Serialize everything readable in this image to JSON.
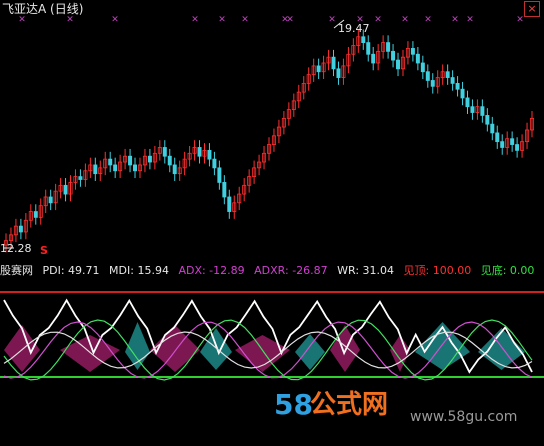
{
  "chart_window": {
    "title": "飞亚达A (日线)",
    "close_label": "×",
    "price_high_label": "19.47",
    "price_low_label": "12.28",
    "signal_label": "S"
  },
  "indicator": {
    "name": "股赛网",
    "items": [
      {
        "key": "PDI",
        "text": "PDI: 49.71",
        "color": "#e8e8e8"
      },
      {
        "key": "MDI",
        "text": "MDI: 15.94",
        "color": "#e8e8e8"
      },
      {
        "key": "ADX",
        "text": "ADX: -12.89",
        "color": "#d040d0"
      },
      {
        "key": "ADXR",
        "text": "ADXR: -26.87",
        "color": "#d040d0"
      },
      {
        "key": "WR",
        "text": "WR: 31.04",
        "color": "#e8e8e8"
      },
      {
        "key": "见顶",
        "text": "见顶: 100.00",
        "color": "#ff3030"
      },
      {
        "key": "见底",
        "text": "见底: 0.00",
        "color": "#30e040"
      }
    ]
  },
  "watermark": {
    "number": "58",
    "chinese": "公式网",
    "url": "www.58gu.com"
  },
  "colors": {
    "up": "#ff3030",
    "down": "#40d0e0",
    "marker": "#c040c0",
    "top_line": "#d02020",
    "bottom_line": "#30d030",
    "wr_line": "#ffffff",
    "fill_a": "#8a1a5a",
    "fill_b": "#1a7a7a"
  },
  "chart_data": {
    "type": "candlestick",
    "price_high": 19.47,
    "price_low": 12.28,
    "closes": [
      12.4,
      12.6,
      12.9,
      12.7,
      13.1,
      13.4,
      13.2,
      13.6,
      13.9,
      13.7,
      14.1,
      14.3,
      14.0,
      14.4,
      14.6,
      14.5,
      14.8,
      15.0,
      14.7,
      14.9,
      15.2,
      15.0,
      14.8,
      15.1,
      15.3,
      15.0,
      14.8,
      15.0,
      15.3,
      15.1,
      15.4,
      15.6,
      15.3,
      15.0,
      14.7,
      14.9,
      15.2,
      15.4,
      15.6,
      15.3,
      15.5,
      15.2,
      14.9,
      14.4,
      13.9,
      13.4,
      13.7,
      14.0,
      14.3,
      14.6,
      14.9,
      15.1,
      15.4,
      15.7,
      16.0,
      16.3,
      16.6,
      16.9,
      17.2,
      17.5,
      17.8,
      18.1,
      18.4,
      18.2,
      18.5,
      18.7,
      18.3,
      18.0,
      18.4,
      18.8,
      19.1,
      19.4,
      19.2,
      18.8,
      18.5,
      18.9,
      19.2,
      18.9,
      18.6,
      18.3,
      18.7,
      19.0,
      18.8,
      18.5,
      18.2,
      17.9,
      17.7,
      18.0,
      18.2,
      18.0,
      17.8,
      17.6,
      17.3,
      17.0,
      16.8,
      17.0,
      16.7,
      16.4,
      16.1,
      15.8,
      15.6,
      15.9,
      15.7,
      15.5,
      15.8,
      16.2,
      16.6
    ]
  }
}
